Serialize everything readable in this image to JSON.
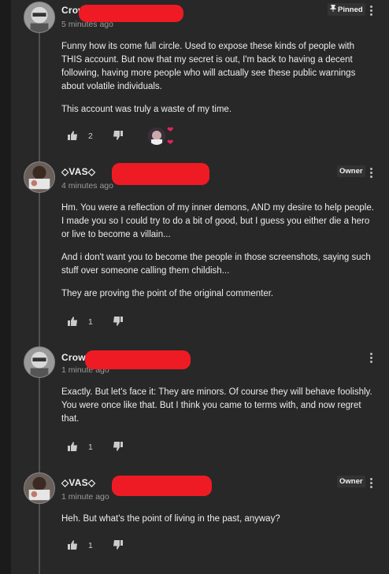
{
  "comments": [
    {
      "author": "Crow",
      "time": "5 minutes ago",
      "badge": "Pinned",
      "paragraphs": [
        "Funny how its come full circle. Used to expose these kinds of people with THIS account. But now that my secret is out, I'm back to having a decent following, having more people who will actually see these public warnings about volatile individuals.",
        "This account was truly a waste of my time."
      ],
      "likes": "2"
    },
    {
      "author": "◇VAS◇",
      "time": "4 minutes ago",
      "badge": "Owner",
      "paragraphs": [
        "Hm. You were a reflection of my inner demons, AND my desire to help people. I made you so I could try to do a bit of good, but I guess you either die a hero or live to become a villain...",
        "And i don't want you to become the people in those screenshots, saying such stuff over someone calling them childish...",
        "They are proving the point of the original commenter."
      ],
      "likes": "1"
    },
    {
      "author": "Crow",
      "time": "1 minute ago",
      "badge": "",
      "paragraphs": [
        "Exactly. But let's face it: They are minors. Of course they will behave foolishly. You were once like that. But I think you came to terms with, and now regret that."
      ],
      "likes": "1"
    },
    {
      "author": "◇VAS◇",
      "time": "1 minute ago",
      "badge": "Owner",
      "paragraphs": [
        "Heh. But what's the point of living in the past, anyway?"
      ],
      "likes": "1"
    }
  ],
  "icons": {
    "like": "thumbs-up-icon",
    "dislike": "thumbs-down-icon",
    "more": "more-vertical-icon",
    "pin": "pin-icon",
    "heart": "heart-icon"
  },
  "colors": {
    "background": "#282828",
    "redaction": "#ee1b24",
    "heart": "#e0245e"
  }
}
